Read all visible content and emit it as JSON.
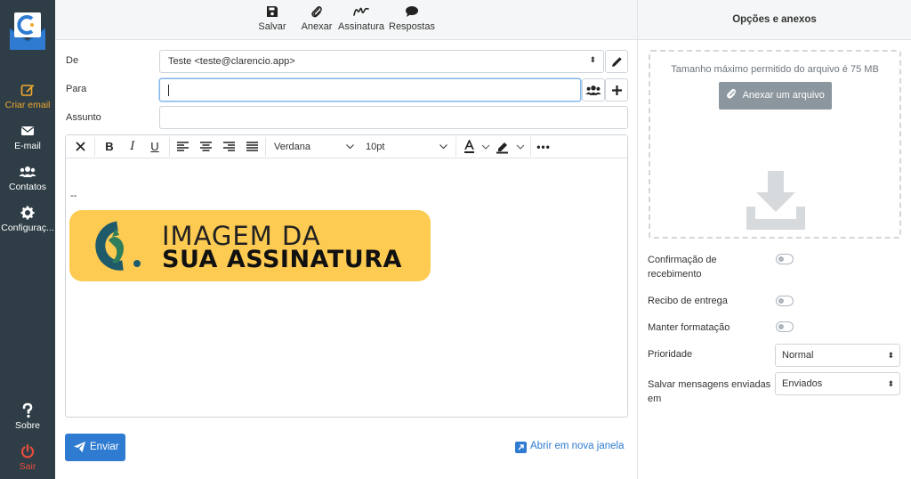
{
  "sidebar": {
    "items": [
      {
        "label": "Criar email",
        "icon": "edit-icon"
      },
      {
        "label": "E-mail",
        "icon": "envelope-icon"
      },
      {
        "label": "Contatos",
        "icon": "users-icon"
      },
      {
        "label": "Configuraç...",
        "icon": "gear-icon"
      }
    ],
    "bottom": [
      {
        "label": "Sobre",
        "icon": "question-icon"
      },
      {
        "label": "Sair",
        "icon": "power-icon"
      }
    ]
  },
  "toolbar": {
    "save": "Salvar",
    "attach": "Anexar",
    "signature": "Assinatura",
    "responses": "Respostas"
  },
  "form": {
    "from_label": "De",
    "from_value": "Teste <teste@clarencio.app>",
    "to_label": "Para",
    "to_value": "",
    "subject_label": "Assunto",
    "subject_value": ""
  },
  "editor": {
    "font_family": "Verdana",
    "font_size": "10pt",
    "signature_separator": "--",
    "signature_line1": "IMAGEM DA",
    "signature_line2": "SUA ASSINATURA"
  },
  "actions": {
    "send": "Enviar",
    "open_new_window": "Abrir em nova janela"
  },
  "right_panel": {
    "title": "Opções e anexos",
    "max_size": "Tamanho máximo permitido do arquivo é 75 MB",
    "attach_button": "Anexar um arquivo",
    "read_receipt": "Confirmação de recebimento",
    "delivery_receipt": "Recibo de entrega",
    "keep_formatting": "Manter formatação",
    "priority_label": "Prioridade",
    "priority_value": "Normal",
    "save_sent_label": "Salvar mensagens enviadas em",
    "save_sent_value": "Enviados"
  },
  "colors": {
    "sidebar": "#2f3e46",
    "accent": "#f0a92e",
    "primary": "#2e7bd1",
    "logout": "#e74c3c",
    "signature_bg": "#fecb52"
  }
}
